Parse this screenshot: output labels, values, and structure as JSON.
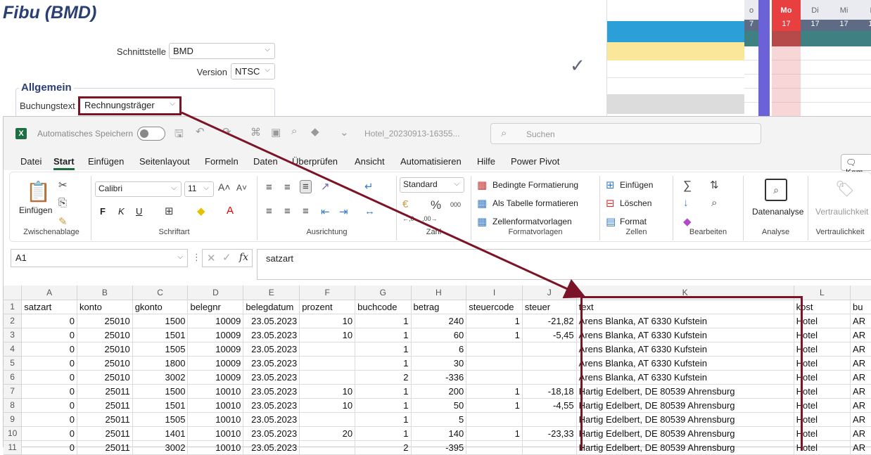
{
  "bgapp": {
    "title": "Fibu (BMD)",
    "schnittstelle_label": "Schnittstelle",
    "schnittstelle_value": "BMD",
    "version_label": "Version",
    "version_value": "NTSC",
    "allgemein_label": "Allgemein",
    "buchungstext_label": "Buchungstext",
    "buchungstext_value": "Rechnungsträger"
  },
  "calendar": {
    "days": [
      {
        "name": "o",
        "num": "7"
      },
      {
        "name": "Mo",
        "num": "17"
      },
      {
        "name": "Di",
        "num": "17"
      },
      {
        "name": "Mi",
        "num": "17"
      },
      {
        "name": "D",
        "num": "17"
      }
    ],
    "colors": {
      "blue": "#2a9fd8",
      "yellow": "#fbe79a",
      "gray": "#dcdcdc",
      "purple": "#6a62d6",
      "teal": "#3f8083",
      "monday": "#e84040"
    }
  },
  "excel": {
    "autosave_label": "Automatisches Speichern",
    "filename": "Hotel_20230913-16355...",
    "search_placeholder": "Suchen",
    "menu": [
      "Datei",
      "Start",
      "Einfügen",
      "Seitenlayout",
      "Formeln",
      "Daten",
      "Überprüfen",
      "Ansicht",
      "Automatisieren",
      "Hilfe",
      "Power Pivot"
    ],
    "comment_button": "Kom",
    "ribbon": {
      "paste": "Einfügen",
      "clipboard_group": "Zwischenablage",
      "font_name": "Calibri",
      "font_size": "11",
      "font_group": "Schriftart",
      "bold": "F",
      "italic": "K",
      "underline": "U",
      "align_group": "Ausrichtung",
      "number_format": "Standard",
      "number_group": "Zahl",
      "cond_format": "Bedingte Formatierung",
      "as_table": "Als Tabelle formatieren",
      "cell_styles": "Zellenformatvorlagen",
      "styles_group": "Formatvorlagen",
      "insert": "Einfügen",
      "delete": "Löschen",
      "format": "Format",
      "cells_group": "Zellen",
      "edit_group": "Bearbeiten",
      "analysis_btn": "Datenanalyse",
      "analysis_group": "Analyse",
      "confidential_btn": "Vertraulichkeit",
      "confidential_group": "Vertraulichkeit"
    },
    "namebox": "A1",
    "formula": "satzart",
    "fx": "fx",
    "columns": [
      "A",
      "B",
      "C",
      "D",
      "E",
      "F",
      "G",
      "H",
      "I",
      "J",
      "K",
      "L",
      ""
    ],
    "rows": [
      {
        "n": "1",
        "c": [
          "satzart",
          "konto",
          "gkonto",
          "belegnr",
          "belegdatum",
          "prozent",
          "buchcode",
          "betrag",
          "steuercode",
          "steuer",
          "text",
          "kost",
          "bu"
        ]
      },
      {
        "n": "2",
        "c": [
          "0",
          "25010",
          "1500",
          "10009",
          "23.05.2023",
          "10",
          "1",
          "240",
          "1",
          "-21,82",
          "Arens Blanka, AT 6330 Kufstein",
          "Hotel",
          "AR"
        ]
      },
      {
        "n": "3",
        "c": [
          "0",
          "25010",
          "1501",
          "10009",
          "23.05.2023",
          "10",
          "1",
          "60",
          "1",
          "-5,45",
          "Arens Blanka, AT 6330 Kufstein",
          "Hotel",
          "AR"
        ]
      },
      {
        "n": "4",
        "c": [
          "0",
          "25010",
          "1505",
          "10009",
          "23.05.2023",
          "",
          "1",
          "6",
          "",
          "",
          "Arens Blanka, AT 6330 Kufstein",
          "Hotel",
          "AR"
        ]
      },
      {
        "n": "5",
        "c": [
          "0",
          "25010",
          "1800",
          "10009",
          "23.05.2023",
          "",
          "1",
          "30",
          "",
          "",
          "Arens Blanka, AT 6330 Kufstein",
          "Hotel",
          "AR"
        ]
      },
      {
        "n": "6",
        "c": [
          "0",
          "25010",
          "3002",
          "10009",
          "23.05.2023",
          "",
          "2",
          "-336",
          "",
          "",
          "Arens Blanka, AT 6330 Kufstein",
          "Hotel",
          "AR"
        ]
      },
      {
        "n": "7",
        "c": [
          "0",
          "25011",
          "1500",
          "10010",
          "23.05.2023",
          "10",
          "1",
          "200",
          "1",
          "-18,18",
          "Hartig Edelbert, DE 80539 Ahrensburg",
          "Hotel",
          "AR"
        ]
      },
      {
        "n": "8",
        "c": [
          "0",
          "25011",
          "1501",
          "10010",
          "23.05.2023",
          "10",
          "1",
          "50",
          "1",
          "-4,55",
          "Hartig Edelbert, DE 80539 Ahrensburg",
          "Hotel",
          "AR"
        ]
      },
      {
        "n": "9",
        "c": [
          "0",
          "25011",
          "1505",
          "10010",
          "23.05.2023",
          "",
          "1",
          "5",
          "",
          "",
          "Hartig Edelbert, DE 80539 Ahrensburg",
          "Hotel",
          "AR"
        ]
      },
      {
        "n": "10",
        "c": [
          "0",
          "25011",
          "1401",
          "10010",
          "23.05.2023",
          "20",
          "1",
          "140",
          "1",
          "-23,33",
          "Hartig Edelbert, DE 80539 Ahrensburg",
          "Hotel",
          "AR"
        ]
      },
      {
        "n": "11",
        "c": [
          "0",
          "25011",
          "3002",
          "10010",
          "23.05.2023",
          "",
          "2",
          "-395",
          "",
          "",
          "Hartig Edelbert, DE 80539 Ahrensburg",
          "Hotel",
          "AR"
        ]
      }
    ],
    "annotation_color": "#7b1426"
  }
}
